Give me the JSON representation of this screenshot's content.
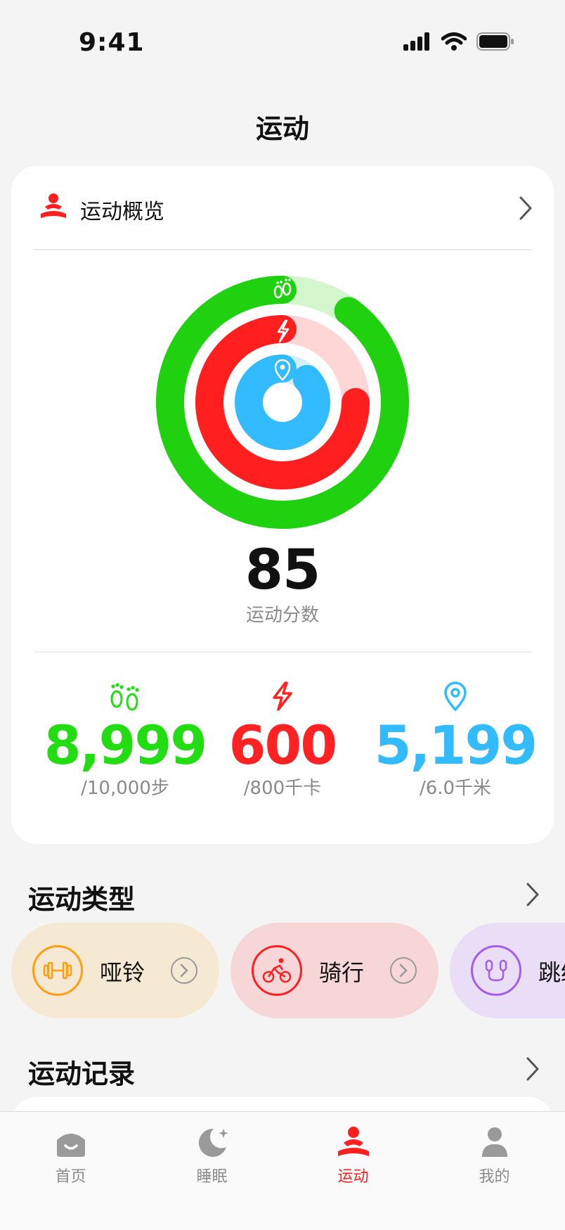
{
  "status_bar": {
    "time": "9:41"
  },
  "page": {
    "title": "运动"
  },
  "overview": {
    "title": "运动概览",
    "score": "85",
    "score_label": "运动分数",
    "rings": {
      "steps_progress": 0.9,
      "calories_progress": 0.75,
      "distance_progress": 0.87
    },
    "stats": [
      {
        "name": "steps",
        "value": "8,999",
        "goal": "/10,000步",
        "color": "#22dd11",
        "icon": "footprints-icon"
      },
      {
        "name": "calories",
        "value": "600",
        "goal": "/800千卡",
        "color": "#ff2222",
        "icon": "lightning-icon"
      },
      {
        "name": "distance",
        "value": "5,199",
        "goal": "/6.0千米",
        "color": "#33bbff",
        "icon": "location-pin-icon"
      }
    ]
  },
  "sport_types": {
    "title": "运动类型",
    "items": [
      {
        "label": "哑铃",
        "icon": "dumbbell-icon",
        "bg": "#f6e9d4",
        "color": "#ff9f10"
      },
      {
        "label": "骑行",
        "icon": "cycling-icon",
        "bg": "#f6d6d6",
        "color": "#ff1f1f"
      },
      {
        "label": "跳绳",
        "icon": "jump-rope-icon",
        "bg": "#e9def6",
        "color": "#a35cf0"
      }
    ]
  },
  "sport_records": {
    "title": "运动记录"
  },
  "tabbar": {
    "items": [
      {
        "label": "首页",
        "icon": "home-icon"
      },
      {
        "label": "睡眠",
        "icon": "moon-icon"
      },
      {
        "label": "运动",
        "icon": "exercise-icon",
        "active": true
      },
      {
        "label": "我的",
        "icon": "person-icon"
      }
    ]
  }
}
